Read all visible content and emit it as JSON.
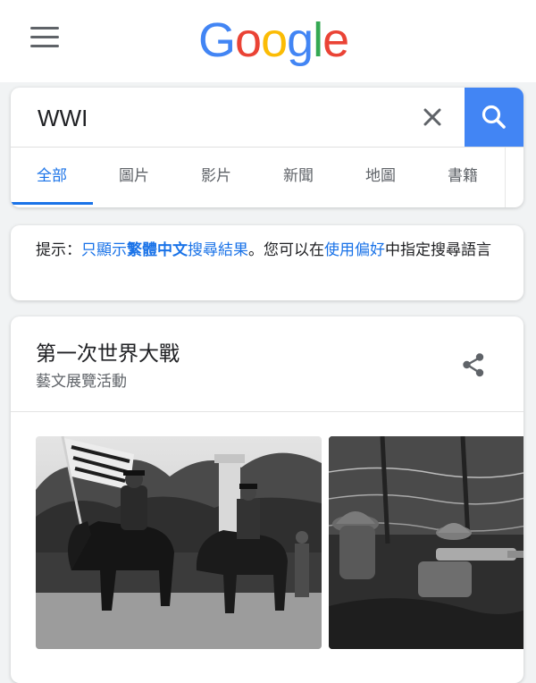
{
  "logo": {
    "letters": [
      {
        "ch": "G",
        "color": "#4285F4"
      },
      {
        "ch": "o",
        "color": "#EA4335"
      },
      {
        "ch": "o",
        "color": "#FBBC05"
      },
      {
        "ch": "g",
        "color": "#4285F4"
      },
      {
        "ch": "l",
        "color": "#34A853"
      },
      {
        "ch": "e",
        "color": "#EA4335"
      }
    ]
  },
  "search": {
    "value": "WWI"
  },
  "tabs": [
    {
      "label": "全部",
      "active": true
    },
    {
      "label": "圖片",
      "active": false
    },
    {
      "label": "影片",
      "active": false
    },
    {
      "label": "新聞",
      "active": false
    },
    {
      "label": "地圖",
      "active": false
    },
    {
      "label": "書籍",
      "active": false
    }
  ],
  "hint": {
    "prefix": "提示：",
    "link1": "只顯示",
    "bold_link": "繁體中文",
    "link2": "搜尋結果",
    "mid": "。您可以在",
    "link3": "使用偏好",
    "suffix": "中指定搜尋語言"
  },
  "knowledge_panel": {
    "title": "第一次世界大戰",
    "subtitle": "藝文展覽活動"
  },
  "icons": {
    "menu": "hamburger-menu-icon",
    "clear": "close-icon",
    "search": "search-icon",
    "share": "share-icon"
  },
  "colors": {
    "accent": "#1a73e8",
    "search_button": "#4285f4"
  }
}
